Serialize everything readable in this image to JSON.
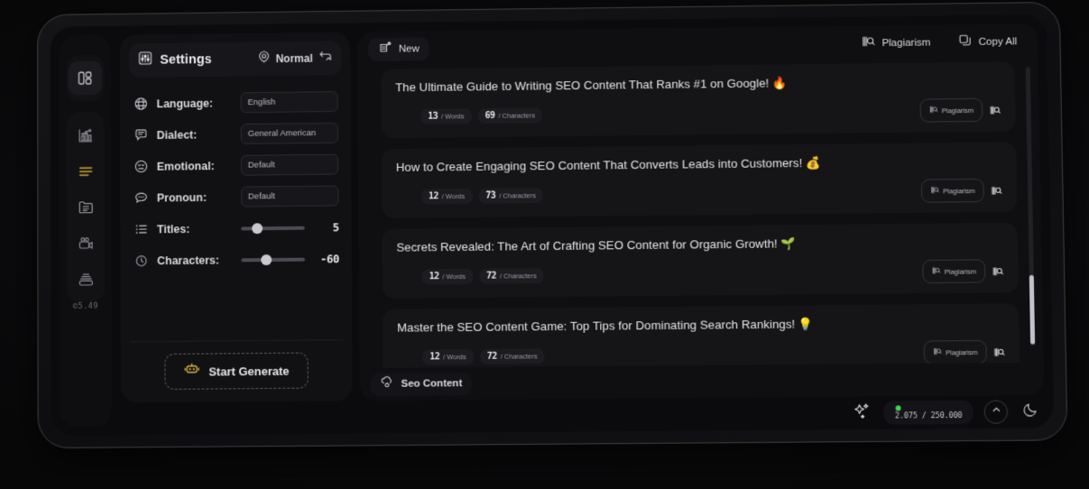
{
  "sidebar": {
    "avatar_icon": "penguin-avatar",
    "items": [
      {
        "icon": "dashboard-grid-icon",
        "name": "dashboard",
        "active": true
      },
      {
        "icon": "chart-bar-icon",
        "name": "analytics",
        "active": false
      },
      {
        "icon": "text-lines-icon",
        "name": "writer",
        "active": true
      },
      {
        "icon": "document-folder-icon",
        "name": "documents",
        "active": false
      },
      {
        "icon": "video-camera-icon",
        "name": "video",
        "active": false
      },
      {
        "icon": "layers-stack-icon",
        "name": "layers",
        "active": false
      }
    ],
    "version": "©5.49"
  },
  "settings": {
    "title": "Settings",
    "title_icon": "sliders-icon",
    "mode_icon": "mode-target-icon",
    "mode_label": "Normal",
    "mode_toggle_icon": "swap-arrows-icon",
    "fields": [
      {
        "icon": "globe-icon",
        "label": "Language:",
        "value": "English",
        "placeholder": "English"
      },
      {
        "icon": "speech-bubble-icon",
        "label": "Dialect:",
        "value": "General American",
        "placeholder": "General American"
      },
      {
        "icon": "emoji-face-icon",
        "label": "Emotional:",
        "value": "Default",
        "placeholder": "Default"
      },
      {
        "icon": "chat-dots-icon",
        "label": "Pronoun:",
        "value": "Default",
        "placeholder": "Default"
      }
    ],
    "sliders": [
      {
        "icon": "list-icon",
        "label": "Titles:",
        "value": "5",
        "percent": 25
      },
      {
        "icon": "clock-icon",
        "label": "Characters:",
        "value": "-60",
        "percent": 40
      }
    ],
    "generate_icon": "robot-icon",
    "generate_label": "Start Generate"
  },
  "toolbar": {
    "new_icon": "new-document-icon",
    "new_label": "New",
    "plagiarism_icon": "plagiarism-icon",
    "plagiarism_label": "Plagiarism",
    "copy_icon": "copy-icon",
    "copy_label": "Copy All"
  },
  "cards": [
    {
      "title": "The Ultimate Guide to Writing SEO Content That Ranks #1 on Google! 🔥",
      "words": "13",
      "words_unit": "/ Words",
      "characters": "69",
      "characters_unit": "/ Characters",
      "plagiarism_label": "Plagiarism"
    },
    {
      "title": "How to Create Engaging SEO Content That Converts Leads into Customers! 💰",
      "words": "12",
      "words_unit": "/ Words",
      "characters": "73",
      "characters_unit": "/ Characters",
      "plagiarism_label": "Plagiarism"
    },
    {
      "title": "Secrets Revealed: The Art of Crafting SEO Content for Organic Growth! 🌱",
      "words": "12",
      "words_unit": "/ Words",
      "characters": "72",
      "characters_unit": "/ Characters",
      "plagiarism_label": "Plagiarism"
    },
    {
      "title": "Master the SEO Content Game: Top Tips for Dominating Search Rankings! 💡",
      "words": "12",
      "words_unit": "/ Words",
      "characters": "72",
      "characters_unit": "/ Characters",
      "plagiarism_label": "Plagiarism"
    }
  ],
  "footer": {
    "seo_icon": "cloud-node-icon",
    "seo_label": "Seo Content"
  },
  "statusbar": {
    "sparkle_icon": "sparkle-icon",
    "credits": "2.075 / 250.000",
    "status_dot": "online-dot",
    "collapse_icon": "chevron-up-icon",
    "theme_icon": "moon-icon"
  },
  "colors": {
    "accent_yellow": "#d9b43c",
    "online_green": "#3ad94a",
    "panel": "#111114",
    "card": "#151518"
  }
}
